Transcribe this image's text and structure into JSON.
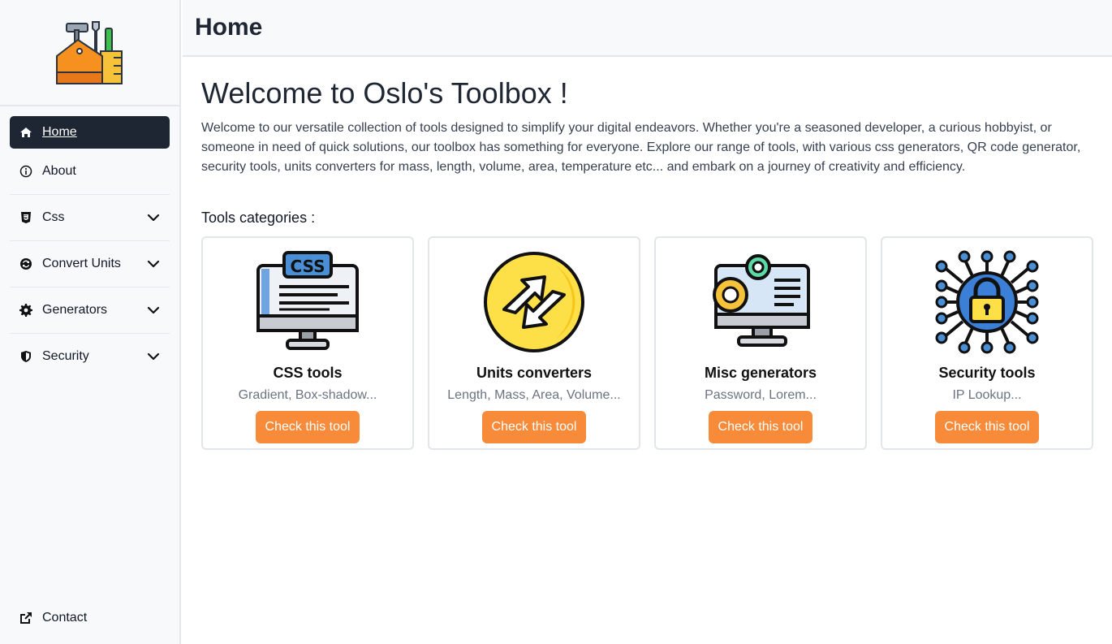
{
  "header": {
    "title": "Home"
  },
  "sidebar": {
    "items": [
      {
        "label": "Home",
        "icon": "home-icon",
        "active": true
      },
      {
        "label": "About",
        "icon": "info-icon"
      },
      {
        "label": "Css",
        "icon": "css3-icon",
        "expandable": true
      },
      {
        "label": "Convert Units",
        "icon": "convert-icon",
        "expandable": true
      },
      {
        "label": "Generators",
        "icon": "gear-icon",
        "expandable": true
      },
      {
        "label": "Security",
        "icon": "shield-icon",
        "expandable": true
      }
    ],
    "contact": {
      "label": "Contact",
      "icon": "external-link-icon"
    }
  },
  "main": {
    "title": "Welcome to Oslo's Toolbox !",
    "intro": "Welcome to our versatile collection of tools designed to simplify your digital endeavors. Whether you're a seasoned developer, a curious hobbyist, or someone in need of quick solutions, our toolbox has something for everyone. Explore our range of tools, with various css generators, QR code generator, security tools, units converters for mass, length, volume, area, temperature etc... and embark on a journey of creativity and efficiency.",
    "categories_title": "Tools categories :",
    "cards": [
      {
        "title": "CSS tools",
        "subtitle": "Gradient, Box-shadow...",
        "button": "Check this tool",
        "icon": "css-monitor-icon"
      },
      {
        "title": "Units converters",
        "subtitle": "Length, Mass, Area, Volume...",
        "button": "Check this tool",
        "icon": "convert-arrows-icon"
      },
      {
        "title": "Misc generators",
        "subtitle": "Password, Lorem...",
        "button": "Check this tool",
        "icon": "gears-monitor-icon"
      },
      {
        "title": "Security tools",
        "subtitle": "IP Lookup...",
        "button": "Check this tool",
        "icon": "lock-network-icon"
      }
    ]
  },
  "colors": {
    "accent": "#f78b3a",
    "dark": "#1e2633",
    "sidebar_bg": "#f8f9fb"
  },
  "logo": {
    "icon": "toolbox-logo-icon"
  }
}
